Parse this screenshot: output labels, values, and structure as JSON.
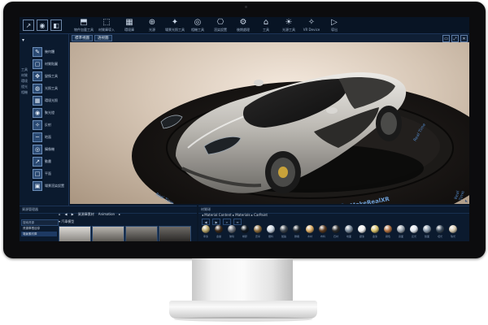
{
  "toolbar": {
    "left_buttons": [
      {
        "icon": "arrow-icon",
        "glyph": "↗"
      },
      {
        "icon": "eye-icon",
        "glyph": "◉"
      },
      {
        "icon": "cube-icon",
        "glyph": "◧"
      }
    ],
    "buttons": [
      {
        "icon": "import-icon",
        "glyph": "⬒",
        "label": "物件加載工具"
      },
      {
        "icon": "cube-icon",
        "glyph": "⬚",
        "label": "材質庫導入"
      },
      {
        "icon": "image-icon",
        "glyph": "▦",
        "label": "環境庫"
      },
      {
        "icon": "globe-icon",
        "glyph": "⊕",
        "label": "光源"
      },
      {
        "icon": "light-icon",
        "glyph": "✦",
        "label": "場景光照工具"
      },
      {
        "icon": "camera-icon",
        "glyph": "◎",
        "label": "相機工具"
      },
      {
        "icon": "render-icon",
        "glyph": "⎔",
        "label": "渲染設置"
      },
      {
        "icon": "gear-icon",
        "glyph": "⚙",
        "label": "後期處理"
      },
      {
        "icon": "home-icon",
        "glyph": "⌂",
        "label": "工具"
      },
      {
        "icon": "bulb-icon",
        "glyph": "☀",
        "label": "光源工具"
      },
      {
        "icon": "vr-icon",
        "glyph": "✧",
        "label": "VR Device"
      },
      {
        "icon": "play-icon",
        "glyph": "▷",
        "label": "導出"
      }
    ]
  },
  "left_panel": {
    "side_labels": [
      "工具",
      "材質",
      "環境",
      "燈光",
      "相機"
    ],
    "tools": [
      {
        "icon": "pen-icon",
        "glyph": "✎",
        "label": "幾何體"
      },
      {
        "icon": "square-icon",
        "glyph": "▢",
        "label": "材質貼圖"
      },
      {
        "icon": "move-icon",
        "glyph": "✥",
        "label": "變換工具"
      },
      {
        "icon": "sphere-icon",
        "glyph": "◍",
        "label": "光照工具"
      },
      {
        "icon": "grid-icon",
        "glyph": "▦",
        "label": "環境光照"
      },
      {
        "icon": "spot-icon",
        "glyph": "◉",
        "label": "聚光燈"
      },
      {
        "icon": "star-icon",
        "glyph": "✧",
        "label": "反射"
      },
      {
        "icon": "line-icon",
        "glyph": "─",
        "label": "地面"
      },
      {
        "icon": "eye-icon",
        "glyph": "◎",
        "label": "攝像機"
      },
      {
        "icon": "arrow-icon",
        "glyph": "↗",
        "label": "動畫"
      },
      {
        "icon": "blank-icon",
        "glyph": "□",
        "label": "平面"
      },
      {
        "icon": "frame-icon",
        "glyph": "▣",
        "label": "場景渲染設置"
      }
    ]
  },
  "viewport": {
    "tabs": [
      "標準視圖",
      "透視圖"
    ],
    "right_buttons": [
      "▭",
      "⤢",
      "✕"
    ],
    "watermark": "MakeRealXR",
    "stand_text": "Real Time",
    "corner": "◣"
  },
  "bottom_left": {
    "title": "資源管理器",
    "crumbs": [
      "⌂",
      "◀",
      "▶",
      "資源庫素材",
      "Animation",
      "▸"
    ],
    "search": "搜索資源",
    "tree": [
      "資源庫根目錄",
      "場景素材庫"
    ],
    "asset_header": "▾ 汽車模型"
  },
  "bottom_right": {
    "title": "材質球",
    "crumb": "◂ Material Content ▸ Materials ▸ CarPaint",
    "tools": [
      "◀",
      "▶",
      "⌕",
      "≡"
    ],
    "material_labels": [
      "車漆",
      "金屬",
      "玻璃",
      "橡膠",
      "皮革",
      "塑料",
      "鍍鉻",
      "碳纖",
      "木材",
      "布料",
      "石材",
      "地面",
      "銀漆",
      "金漆",
      "銅色",
      "霧面",
      "反光",
      "鏡面",
      "啞光",
      "珠光"
    ],
    "material_colors": [
      "#b8a66a",
      "#3c2a1a",
      "#6a6f78",
      "#101820",
      "#8a6a3a",
      "#c9d4e0",
      "#404850",
      "#202830",
      "#d8a860",
      "#5a3a20",
      "#2a2a2a",
      "#7a8a9a",
      "#f0f0f0",
      "#d9c26a",
      "#b07040",
      "#9aa4ae",
      "#e0e6ee",
      "#8a9aaa",
      "#3a4a5a",
      "#d6c9b0"
    ]
  }
}
